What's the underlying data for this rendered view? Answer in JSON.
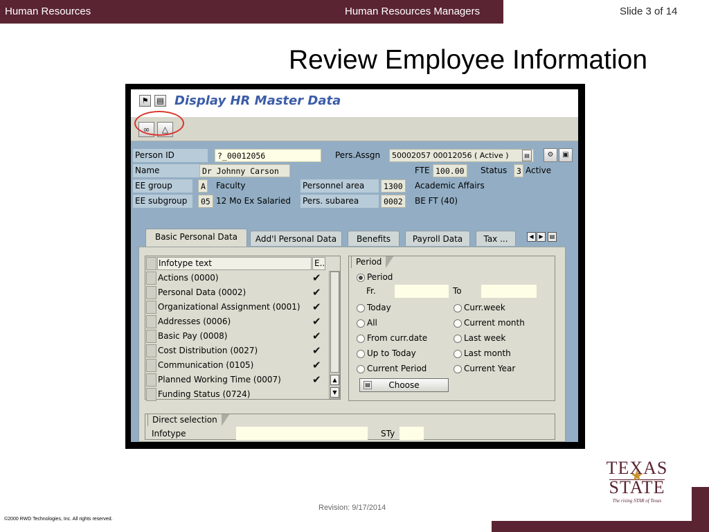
{
  "header": {
    "left_label": "Human Resources",
    "center_label": "Human Resources Managers",
    "slide_number": "Slide 3 of 14"
  },
  "slide_title": "Review Employee Information",
  "sap": {
    "window_title": "Display HR Master Data",
    "fields": {
      "person_id_label": "Person ID",
      "person_id_value": "?_00012056",
      "pers_assgn_label": "Pers.Assgn",
      "pers_assgn_value": "50002057 00012056 ( Active )",
      "name_label": "Name",
      "name_value": "Dr  Johnny  Carson",
      "fte_label": "FTE",
      "fte_value": "100.00",
      "status_label": "Status",
      "status_code": "3",
      "status_text": "Active",
      "ee_group_label": "EE group",
      "ee_group_code": "A",
      "ee_group_text": "Faculty",
      "personnel_area_label": "Personnel area",
      "personnel_area_code": "1300",
      "personnel_area_text": "Academic Affairs",
      "ee_subgroup_label": "EE subgroup",
      "ee_subgroup_code": "05",
      "ee_subgroup_text": "12 Mo Ex Salaried",
      "pers_subarea_label": "Pers. subarea",
      "pers_subarea_code": "0002",
      "pers_subarea_text": "BE FT (40)"
    },
    "tabs": [
      "Basic Personal Data",
      "Add'l Personal Data",
      "Benefits",
      "Payroll Data",
      "Tax ..."
    ],
    "infotype_header": "Infotype text",
    "infotype_col_e": "E..",
    "infotypes": [
      {
        "name": "Actions (0000)",
        "checked": true
      },
      {
        "name": "Personal Data (0002)",
        "checked": true
      },
      {
        "name": "Organizational Assignment (0001)",
        "checked": true
      },
      {
        "name": "Addresses (0006)",
        "checked": true
      },
      {
        "name": "Basic Pay (0008)",
        "checked": true
      },
      {
        "name": "Cost Distribution (0027)",
        "checked": true
      },
      {
        "name": "Communication (0105)",
        "checked": true
      },
      {
        "name": "Planned Working Time (0007)",
        "checked": true
      },
      {
        "name": "Funding Status (0724)",
        "checked": false
      }
    ],
    "period": {
      "group_title": "Period",
      "period_option": "Period",
      "from_label": "Fr.",
      "to_label": "To",
      "options_left": [
        "Today",
        "All",
        "From curr.date",
        "Up to Today",
        "Current Period"
      ],
      "options_right": [
        "Curr.week",
        "Current month",
        "Last week",
        "Last month",
        "Current Year"
      ],
      "choose_button": "Choose"
    },
    "direct_selection": {
      "group_title": "Direct selection",
      "infotype_label": "Infotype",
      "sty_label": "STy"
    }
  },
  "footer": {
    "revision": "Revision: 9/17/2014",
    "copyright": "©2000 RWD Technologies, Inc.  All rights reserved.",
    "logo_line1": "TEXAS",
    "logo_line2": "STATE",
    "logo_tagline": "The rising STAR of Texas"
  },
  "colors": {
    "brand_maroon": "#5a2432",
    "sap_background": "#93aec4",
    "sap_title": "#3b5ca8",
    "annotation_red": "#d9342b"
  }
}
